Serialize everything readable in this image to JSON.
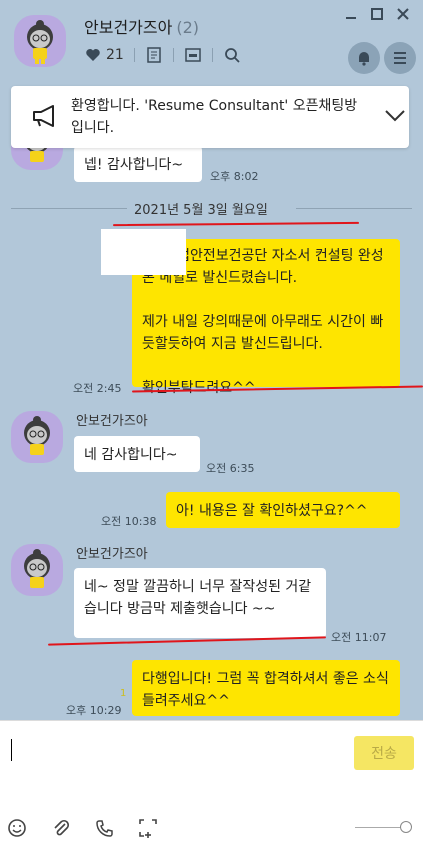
{
  "header": {
    "title": "안보건가즈아",
    "member_count": "(2)",
    "likes": "21",
    "window_controls": [
      "minimize-icon",
      "maximize-icon",
      "close-icon"
    ],
    "icons": [
      "heart-icon",
      "notes-icon",
      "archive-icon",
      "search-icon",
      "bell-icon",
      "menu-icon"
    ]
  },
  "notice": {
    "text": "환영합니다. 'Resume Consultant' 오픈채팅방입니다."
  },
  "messages": [
    {
      "side": "other",
      "text": "넵! 감사합니다~",
      "time": "오후 8:02"
    },
    {
      "side": "me",
      "text": "   , 산업안전보건공단 자소서 컨설팅 완성본 메일로 발신드렸습니다.\n\n제가 내일 강의때문에 아무래도 시간이 빠듯할듯하여 지금 발신드립니다.\n\n확인부탁드려요^^",
      "time": "오전 2:45"
    },
    {
      "side": "other",
      "sender": "안보건가즈아",
      "text": "네 감사합니다~",
      "time": "오전 6:35"
    },
    {
      "side": "me",
      "text": "아! 내용은 잘 확인하셨구요?^^",
      "time": "오전 10:38"
    },
    {
      "side": "other",
      "sender": "안보건가즈아",
      "text": "네~ 정말 깔끔하니 너무 잘작성된 거같습니다  방금막 제출햇습니다 ~~",
      "time": "오전 11:07"
    },
    {
      "side": "me",
      "text": "다행입니다! 그럼 꼭 합격하셔서 좋은 소식 들려주세요^^",
      "time": "오후 10:29",
      "unread": "1"
    }
  ],
  "date_separator": "2021년 5월 3일 월요일",
  "input": {
    "value": "",
    "send_label": "전송",
    "toolbar_icons": [
      "emoji-icon",
      "attach-icon",
      "call-icon",
      "capture-icon"
    ]
  },
  "colors": {
    "background": "#b2c7d9",
    "my_bubble": "#fee500",
    "other_bubble": "#ffffff",
    "annotation": "#e0151b"
  }
}
